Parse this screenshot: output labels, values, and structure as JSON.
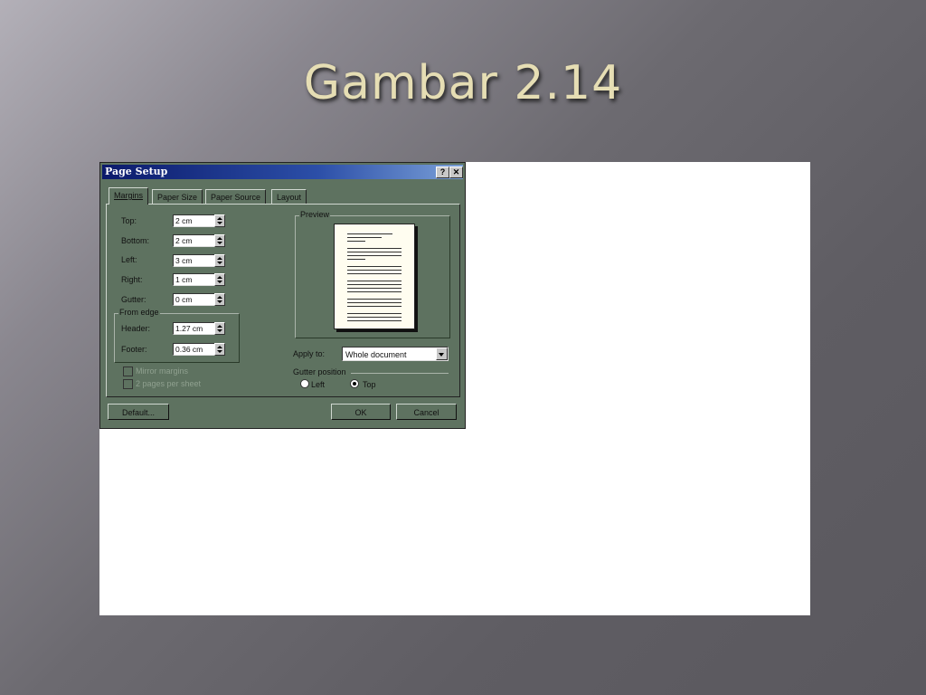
{
  "slide": {
    "title": "Gambar 2.14"
  },
  "dialog": {
    "title": "Page Setup",
    "help_button": "?",
    "close_button": "✕",
    "tabs": [
      {
        "label": "Margins",
        "active": true
      },
      {
        "label": "Paper Size",
        "active": false
      },
      {
        "label": "Paper Source",
        "active": false
      },
      {
        "label": "Layout",
        "active": false
      }
    ],
    "margins": {
      "top": {
        "label": "Top:",
        "value": "2 cm"
      },
      "bottom": {
        "label": "Bottom:",
        "value": "2 cm"
      },
      "left": {
        "label": "Left:",
        "value": "3 cm"
      },
      "right": {
        "label": "Right:",
        "value": "1 cm"
      },
      "gutter": {
        "label": "Gutter:",
        "value": "0 cm"
      }
    },
    "from_edge": {
      "title": "From edge",
      "header": {
        "label": "Header:",
        "value": "1.27 cm"
      },
      "footer": {
        "label": "Footer:",
        "value": "0.36 cm"
      }
    },
    "mirror_margins": {
      "label": "Mirror margins",
      "checked": false
    },
    "two_pages": {
      "label": "2 pages per sheet",
      "checked": false
    },
    "preview": {
      "title": "Preview"
    },
    "apply_to": {
      "label": "Apply to:",
      "value": "Whole document"
    },
    "gutter_position": {
      "title": "Gutter position",
      "left": "Left",
      "top": "Top",
      "selected": "top"
    },
    "buttons": {
      "default": "Default...",
      "ok": "OK",
      "cancel": "Cancel"
    }
  }
}
